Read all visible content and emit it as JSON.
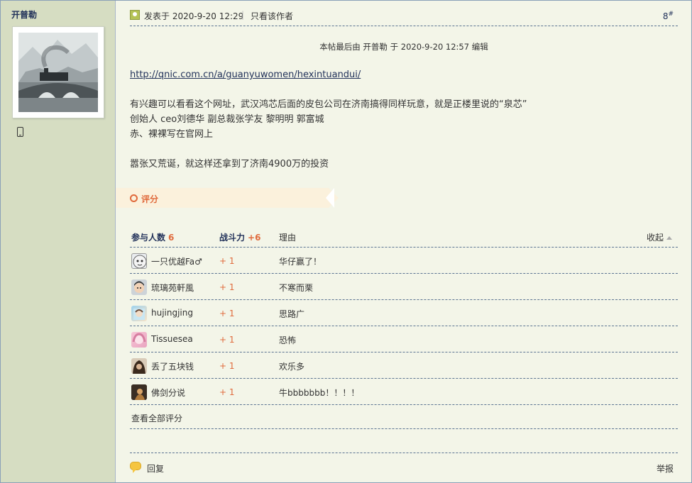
{
  "author": {
    "name": "开普勒",
    "device_icon": "mobile-phone-icon"
  },
  "post": {
    "posted_at": "发表于 2020-9-20 12:29",
    "separator": "|",
    "only_author": "只看该作者",
    "floor_num": "8",
    "floor_mark": "#",
    "edit_note": "本帖最后由 开普勒 于 2020-9-20 12:57 编辑",
    "link": "http://qnic.com.cn/a/guanyuwomen/hexintuandui/",
    "lines": [
      "有兴趣可以看看这个网址，武汉鸿芯后面的皮包公司在济南搞得同样玩意，就是正楼里说的“泉芯”",
      "创始人 ceo刘德华 副总裁张学友 黎明明 郭富城",
      "赤、裸裸写在官网上"
    ],
    "closing": "嚣张又荒诞，就这样还拿到了济南4900万的投资"
  },
  "rating": {
    "label": "评分",
    "header": {
      "participants_label": "参与人数",
      "participants_count": "6",
      "power_label": "战斗力",
      "power_total": "+6",
      "reason_label": "理由",
      "collapse_label": "收起"
    },
    "rows": [
      {
        "name": "一只优越Fa♂",
        "score": "+ 1",
        "reason": "华仔赢了！"
      },
      {
        "name": "琉璃苑軒風",
        "score": "+ 1",
        "reason": "不寒而栗"
      },
      {
        "name": "hujingjing",
        "score": "+ 1",
        "reason": "思路广"
      },
      {
        "name": "Tissuesea",
        "score": "+ 1",
        "reason": "恐怖"
      },
      {
        "name": "丢了五块钱",
        "score": "+ 1",
        "reason": "欢乐多"
      },
      {
        "name": "佛剑分说",
        "score": "+ 1",
        "reason": "牛bbbbbbb！！！！"
      }
    ],
    "view_all": "查看全部评分"
  },
  "footer": {
    "reply": "回复",
    "report": "举报"
  },
  "colors": {
    "accent": "#e06a3c",
    "link": "#22325a",
    "sidebar_bg": "#d6ddc2",
    "page_bg": "#f3f5e8"
  }
}
